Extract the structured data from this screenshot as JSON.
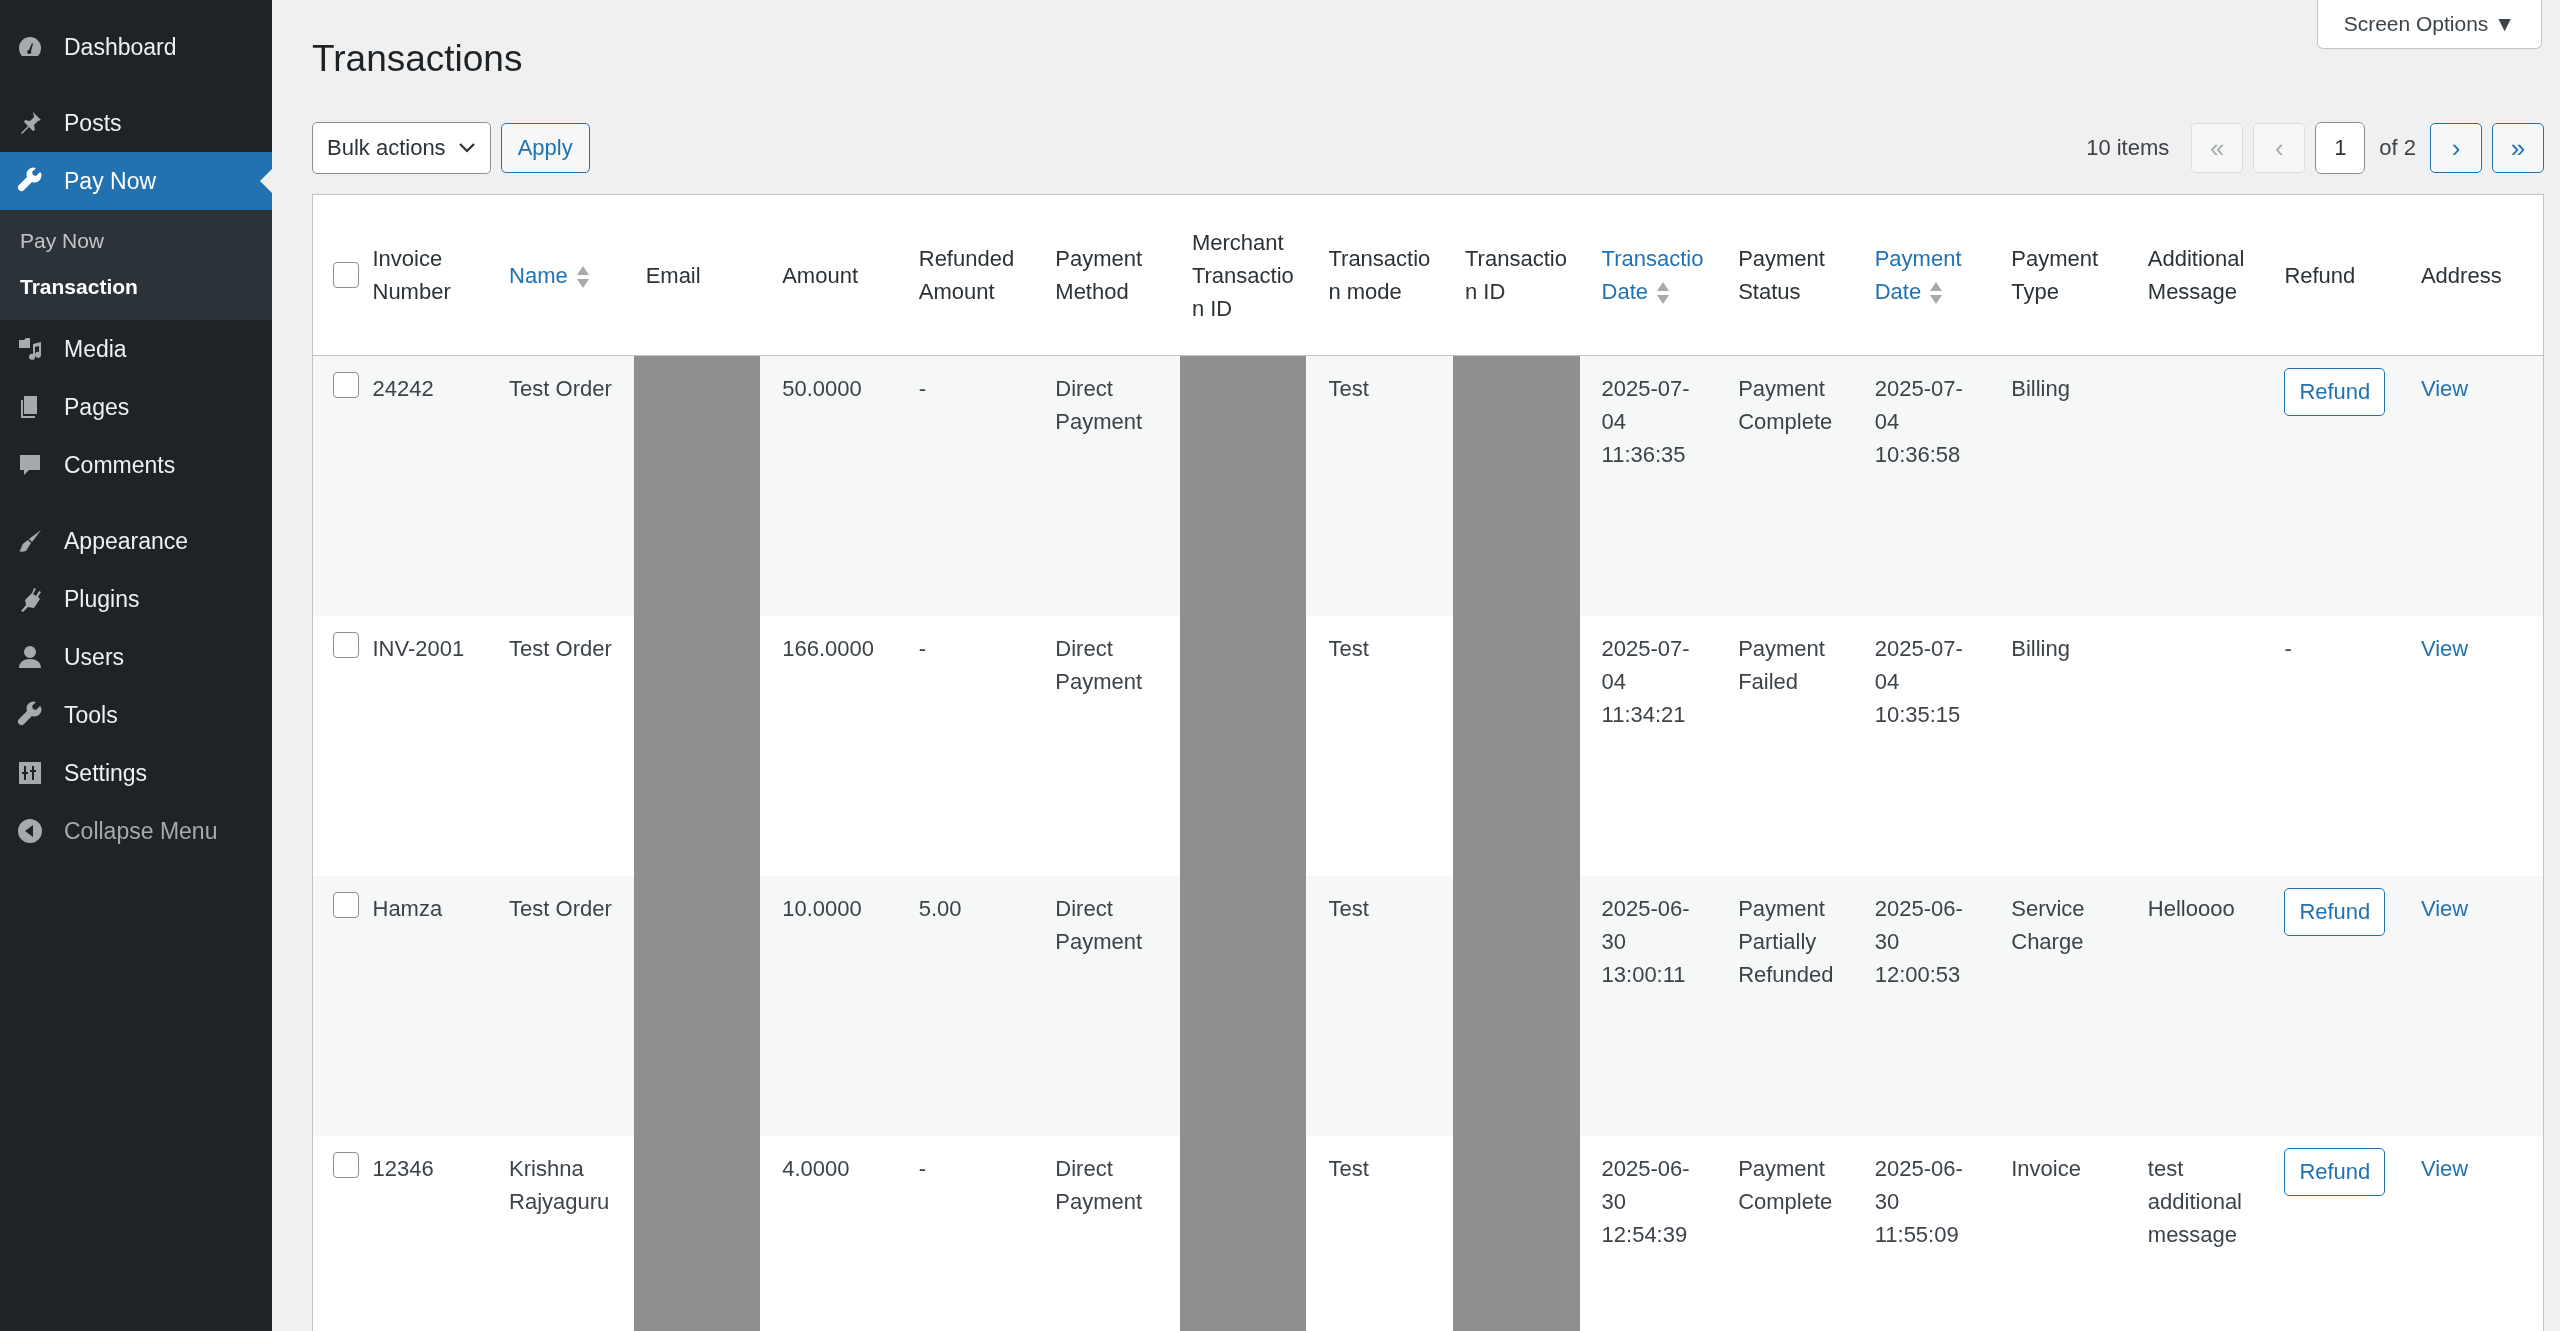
{
  "sidebar": {
    "items": [
      {
        "label": "Dashboard",
        "selected": false
      },
      {
        "label": "Posts",
        "selected": false
      },
      {
        "label": "Pay Now",
        "selected": true,
        "children": [
          {
            "label": "Pay Now",
            "selected": false
          },
          {
            "label": "Transaction",
            "selected": true
          }
        ]
      },
      {
        "label": "Media",
        "selected": false
      },
      {
        "label": "Pages",
        "selected": false
      },
      {
        "label": "Comments",
        "selected": false
      },
      {
        "label": "Appearance",
        "selected": false
      },
      {
        "label": "Plugins",
        "selected": false
      },
      {
        "label": "Users",
        "selected": false
      },
      {
        "label": "Tools",
        "selected": false
      },
      {
        "label": "Settings",
        "selected": false
      },
      {
        "label": "Collapse Menu",
        "selected": false
      }
    ]
  },
  "screen_options": "Screen Options ▼",
  "title": "Transactions",
  "toolbar": {
    "bulk_actions": "Bulk actions",
    "apply": "Apply",
    "items_count": "10 items",
    "first": "«",
    "prev": "‹",
    "page": "1",
    "of": "of 2",
    "next": "›",
    "last": "»"
  },
  "table": {
    "select_all_checked": false,
    "columns": [
      {
        "label": "Invoice Number",
        "sortable": false
      },
      {
        "label": "Name",
        "sortable": true
      },
      {
        "label": "Email",
        "sortable": false
      },
      {
        "label": "Amount",
        "sortable": false
      },
      {
        "label": "Refunded Amount",
        "sortable": false
      },
      {
        "label": "Payment Method",
        "sortable": false
      },
      {
        "label": "Merchant Transaction ID",
        "sortable": false
      },
      {
        "label": "Transaction mode",
        "sortable": false
      },
      {
        "label": "Transaction ID",
        "sortable": false
      },
      {
        "label": "Transactio Date",
        "sortable": true
      },
      {
        "label": "Payment Status",
        "sortable": false
      },
      {
        "label": "Payment Date",
        "sortable": true
      },
      {
        "label": "Payment Type",
        "sortable": false
      },
      {
        "label": "Additional Message",
        "sortable": false
      },
      {
        "label": "Refund",
        "sortable": false
      },
      {
        "label": "Address",
        "sortable": false
      }
    ],
    "rows": [
      {
        "checked": false,
        "cells": [
          "24242",
          "Test Order",
          {
            "kind": "redacted"
          },
          "50.0000",
          "-",
          "Direct Payment",
          {
            "kind": "redacted"
          },
          "Test",
          {
            "kind": "redacted"
          },
          "2025-07-04 11:36:35",
          "Payment Complete",
          "2025-07-04 10:36:58",
          "Billing",
          {
            "kind": "blank"
          },
          {
            "kind": "button",
            "label": "Refund"
          },
          {
            "kind": "link",
            "label": "View"
          }
        ]
      },
      {
        "checked": false,
        "cells": [
          "INV-2001",
          "Test Order",
          {
            "kind": "redacted"
          },
          "166.0000",
          "-",
          "Direct Payment",
          {
            "kind": "redacted"
          },
          "Test",
          {
            "kind": "redacted"
          },
          "2025-07-04 11:34:21",
          "Payment Failed",
          "2025-07-04 10:35:15",
          "Billing",
          {
            "kind": "blank"
          },
          "-",
          {
            "kind": "link",
            "label": "View"
          }
        ]
      },
      {
        "checked": false,
        "cells": [
          "Hamza",
          "Test Order",
          {
            "kind": "redacted"
          },
          "10.0000",
          "5.00",
          "Direct Payment",
          {
            "kind": "redacted"
          },
          "Test",
          {
            "kind": "redacted"
          },
          "2025-06-30 13:00:11",
          "Payment Partially Refunded",
          "2025-06-30 12:00:53",
          "Service Charge",
          "Helloooo",
          {
            "kind": "button",
            "label": "Refund"
          },
          {
            "kind": "link",
            "label": "View"
          }
        ]
      },
      {
        "checked": false,
        "cells": [
          "12346",
          "Krishna Rajyaguru",
          {
            "kind": "redacted"
          },
          "4.0000",
          "-",
          "Direct Payment",
          {
            "kind": "redacted"
          },
          "Test",
          {
            "kind": "redacted"
          },
          "2025-06-30 12:54:39",
          "Payment Complete",
          "2025-06-30 11:55:09",
          "Invoice",
          "test additional message",
          {
            "kind": "button",
            "label": "Refund"
          },
          {
            "kind": "link",
            "label": "View"
          }
        ]
      }
    ]
  }
}
